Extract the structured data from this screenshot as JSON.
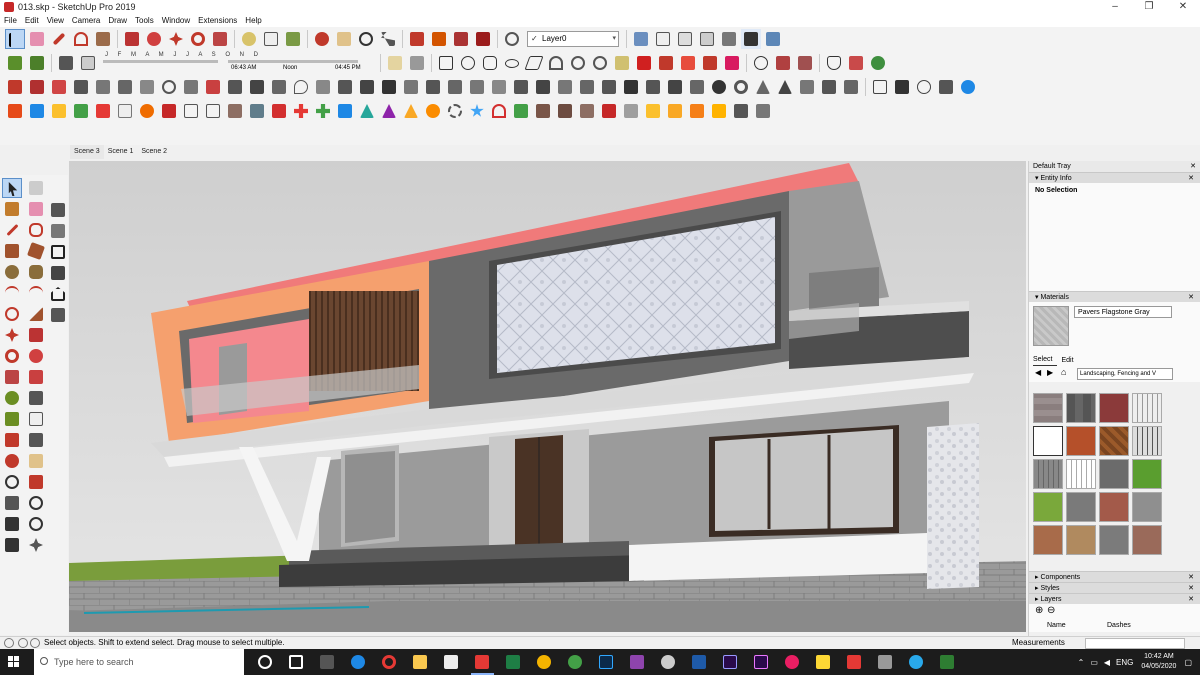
{
  "window": {
    "title": "013.skp - SketchUp Pro 2019",
    "minimize": "–",
    "maximize": "❐",
    "close": "✕"
  },
  "menu": [
    "File",
    "Edit",
    "View",
    "Camera",
    "Draw",
    "Tools",
    "Window",
    "Extensions",
    "Help"
  ],
  "toolbar": {
    "layer_value": "Layer0",
    "layer_check": "✓",
    "shadow_months": "J F M A M J J A S O N D",
    "shadow_time_start": "06:43 AM",
    "shadow_time_mid": "Noon",
    "shadow_time_end": "04:45 PM"
  },
  "scenes": [
    "Scene 3",
    "Scene 1",
    "Scene 2"
  ],
  "tray": {
    "title": "Default Tray",
    "entity_info": {
      "header": "Entity Info",
      "body": "No Selection"
    },
    "materials": {
      "header": "Materials",
      "current": "Pavers Flagstone Gray",
      "tab_select": "Select",
      "tab_edit": "Edit",
      "library": "Landscaping, Fencing and V"
    },
    "collapsed": [
      "Components",
      "Styles",
      "Layers"
    ],
    "layers_cols": {
      "name": "Name",
      "dashes": "Dashes"
    }
  },
  "status": {
    "message": "Select objects. Shift to extend select. Drag mouse to select multiple.",
    "measurements_label": "Measurements"
  },
  "taskbar": {
    "search_placeholder": "Type here to search",
    "language": "ENG",
    "time": "10:42 AM",
    "date": "04/05/2020"
  },
  "colors": {
    "viewport_sky": "#d6d6d6",
    "wall_dark": "#6f6f6f",
    "wall_pink": "#f48a8a",
    "accent_red": "#c62828",
    "taskbar": "#1c1c1c"
  }
}
